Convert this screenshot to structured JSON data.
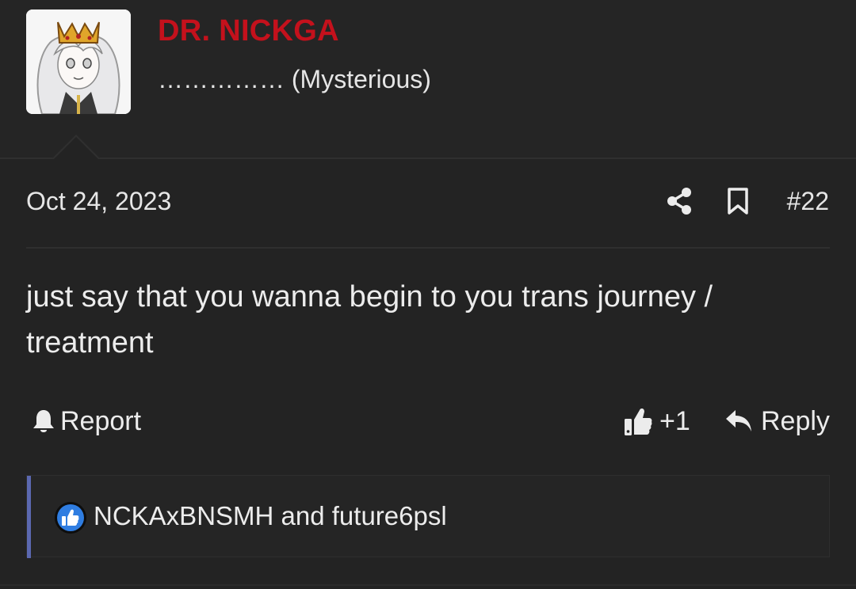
{
  "user": {
    "name": "DR. NICKGA",
    "title": "…………… (Mysterious)",
    "avatar_icon": "avatar-image"
  },
  "post": {
    "date": "Oct 24, 2023",
    "number": "#22",
    "body": "just say that you wanna begin to you trans journey / treatment",
    "share_icon": "share-icon",
    "bookmark_icon": "bookmark-icon"
  },
  "actions": {
    "report_label": "Report",
    "like_count": "+1",
    "reply_label": "Reply"
  },
  "reactions": {
    "text": "NCKAxBNSMH and future6psl",
    "icon": "like-reaction-icon"
  },
  "colors": {
    "background": "#232323",
    "username": "#c4111c",
    "accent_bar": "#5b68b0",
    "reaction_icon": "#2f7de1"
  }
}
